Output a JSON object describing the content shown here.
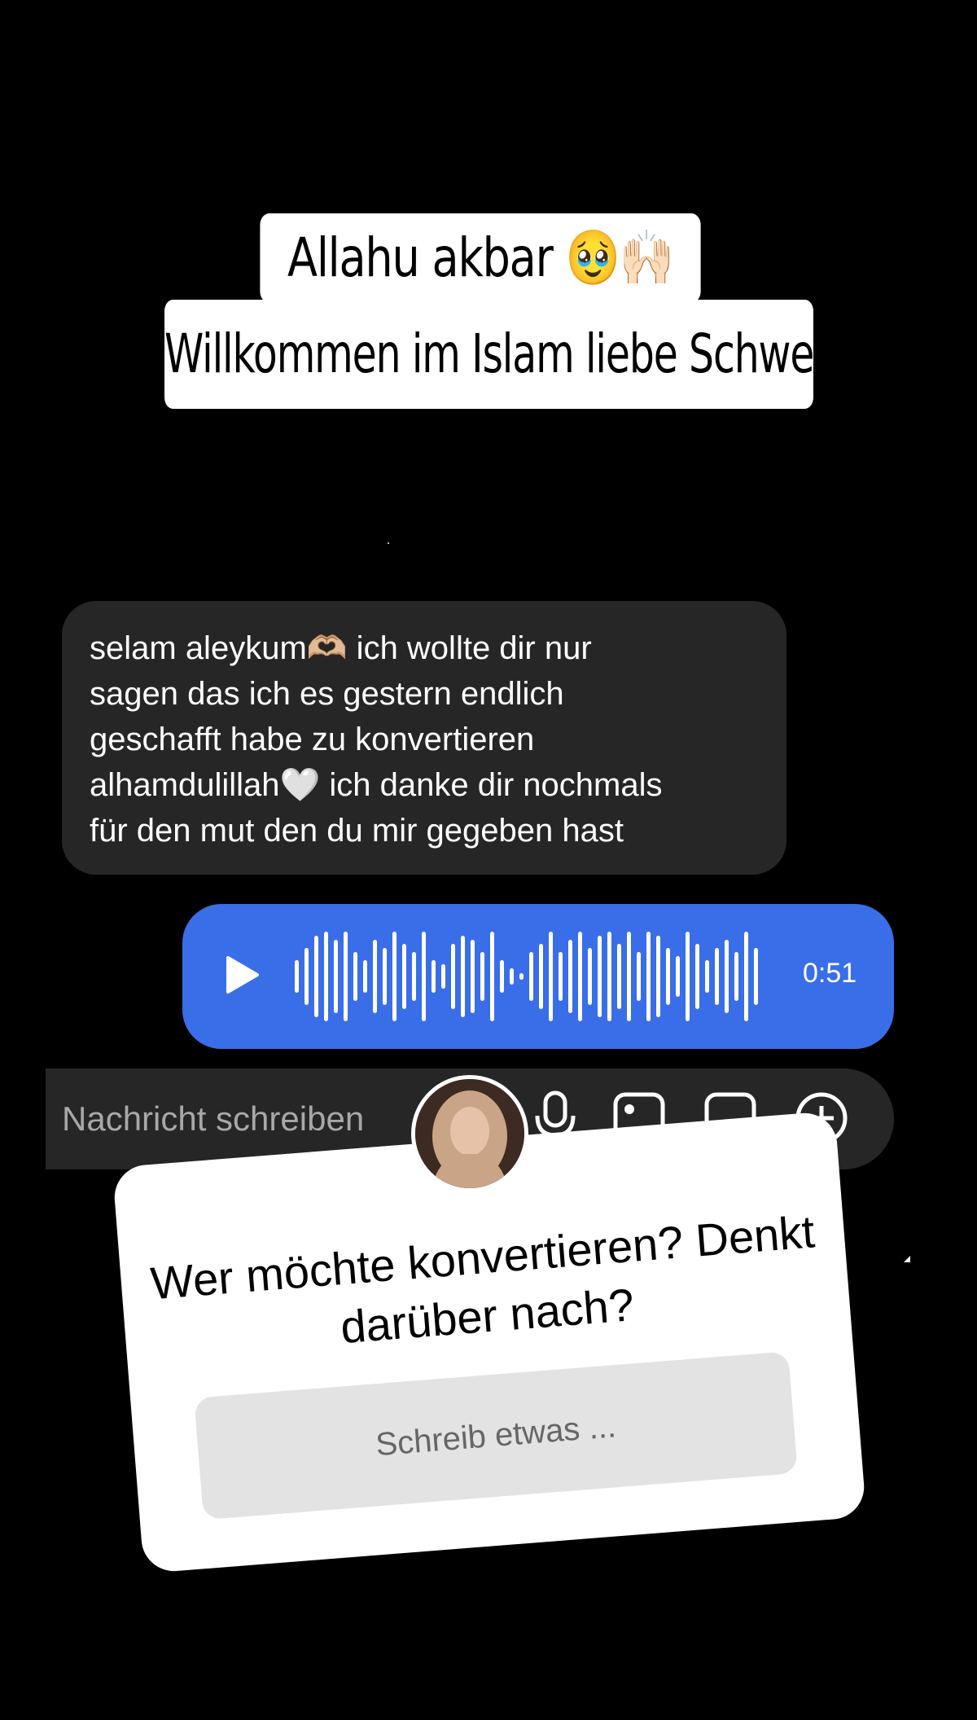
{
  "caption": {
    "line1": "Allahu akbar 🥹🙌🏻",
    "line2": "Willkommen im Islam liebe Schwester"
  },
  "message": {
    "lines": [
      "selam aleykum🫶🏼  ich wollte dir nur",
      "sagen das ich es gestern endlich",
      "geschafft habe zu konvertieren",
      "alhamdulillah🤍  ich danke dir nochmals",
      "für den mut den du mir gegeben hast"
    ]
  },
  "voice_message": {
    "duration": "0:51",
    "play_icon": "play-icon",
    "waveform_icon": "waveform-icon",
    "color": "#3a6ee8"
  },
  "composer": {
    "placeholder": "Nachricht schreiben",
    "icons": [
      "microphone-icon",
      "image-icon",
      "sticker-icon",
      "plus-circle-icon"
    ]
  },
  "question_sticker": {
    "question": "Wer möchte konvertieren? Denkt darüber nach?",
    "answer_placeholder": "Schreib etwas ..."
  }
}
